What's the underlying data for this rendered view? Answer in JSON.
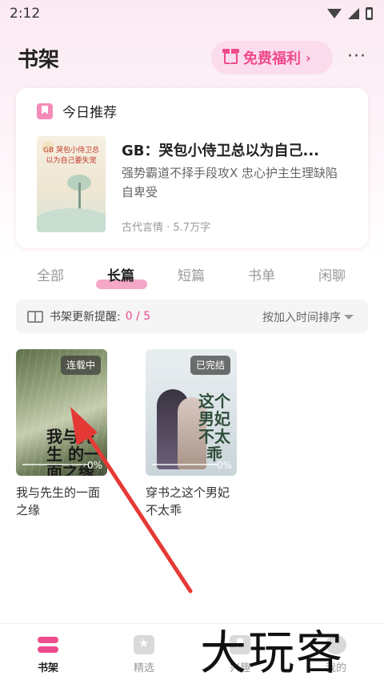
{
  "status_bar": {
    "time": "2:12"
  },
  "header": {
    "title": "书架",
    "benefit_label": "免费福利",
    "benefit_chevron": "›",
    "more": "···"
  },
  "recommendation": {
    "heading": "今日推荐",
    "book": {
      "title": "GB：哭包小侍卫总以为自己...",
      "description": "强势霸道不择手段攻X 忠心护主生理缺陷自卑受",
      "meta": "古代言情 · 5.7万字",
      "cover_text": "GB 哭包小侍卫总以为自己要失宠"
    }
  },
  "tabs": [
    {
      "label": "全部",
      "active": false
    },
    {
      "label": "长篇",
      "active": true
    },
    {
      "label": "短篇",
      "active": false
    },
    {
      "label": "书单",
      "active": false
    },
    {
      "label": "闲聊",
      "active": false
    }
  ],
  "reminder": {
    "label": "书架更新提醒:",
    "count": "0 / 5",
    "sort_label": "按加入时间排序"
  },
  "shelf": [
    {
      "title": "我与先生的一面之缘",
      "status": "连载中",
      "progress": "0%",
      "progress_value": 0,
      "cover_text": "我与先生 的一面之缘"
    },
    {
      "title": "穿书之这个男妃不太乖",
      "status": "已完结",
      "progress": "0%",
      "progress_value": 0,
      "cover_text": "这个男妃 不太乖"
    }
  ],
  "bottom_nav": [
    {
      "label": "书架",
      "active": true
    },
    {
      "label": "精选",
      "active": false
    },
    {
      "label": "兴趣",
      "active": false
    },
    {
      "label": "我的",
      "active": false
    }
  ],
  "watermark": "大玩客",
  "colors": {
    "accent": "#ee4a8e",
    "annotation_arrow": "#e53935"
  }
}
